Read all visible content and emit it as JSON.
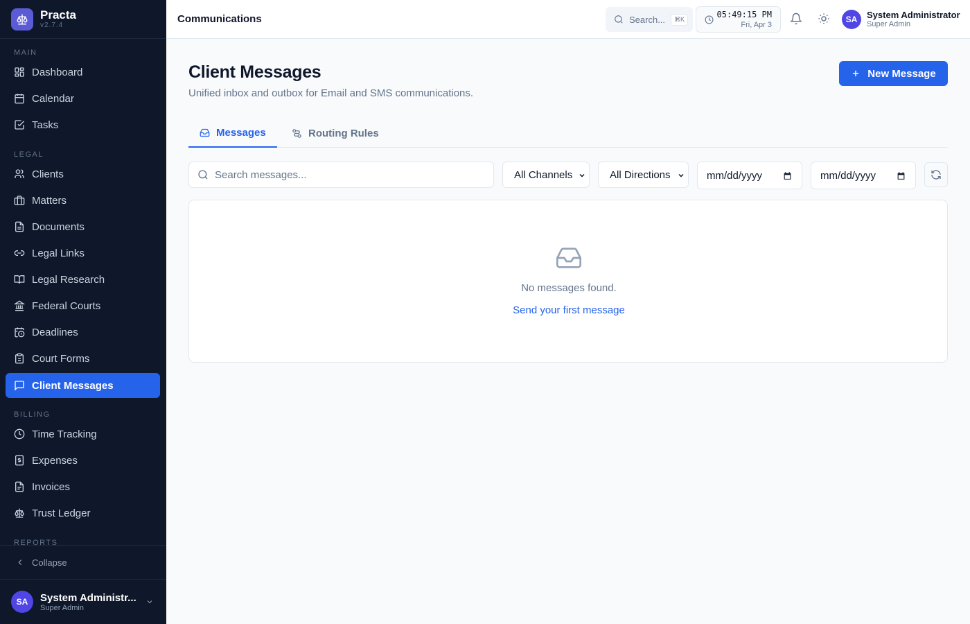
{
  "brand": {
    "name": "Practa",
    "version": "v2.7.4",
    "accent": "#5b5bd6"
  },
  "sidebar": {
    "sections": [
      "MAIN",
      "LEGAL",
      "BILLING",
      "REPORTS"
    ],
    "items": [
      {
        "label": "Dashboard",
        "icon": "dashboard-icon"
      },
      {
        "label": "Calendar",
        "icon": "calendar-icon"
      },
      {
        "label": "Tasks",
        "icon": "tasks-icon"
      },
      {
        "label": "Clients",
        "icon": "users-icon"
      },
      {
        "label": "Matters",
        "icon": "briefcase-icon"
      },
      {
        "label": "Documents",
        "icon": "document-icon"
      },
      {
        "label": "Legal Links",
        "icon": "link-icon"
      },
      {
        "label": "Legal Research",
        "icon": "book-icon"
      },
      {
        "label": "Federal Courts",
        "icon": "courthouse-icon"
      },
      {
        "label": "Deadlines",
        "icon": "calendar-clock-icon"
      },
      {
        "label": "Court Forms",
        "icon": "clipboard-icon"
      },
      {
        "label": "Client Messages",
        "icon": "message-icon",
        "active": true
      },
      {
        "label": "Time Tracking",
        "icon": "clock-icon"
      },
      {
        "label": "Expenses",
        "icon": "receipt-icon"
      },
      {
        "label": "Invoices",
        "icon": "invoice-icon"
      },
      {
        "label": "Trust Ledger",
        "icon": "scale-icon"
      }
    ],
    "collapse_label": "Collapse",
    "user": {
      "initials": "SA",
      "name": "System Administr...",
      "role": "Super Admin"
    }
  },
  "header": {
    "title": "Communications",
    "search_label": "Search...",
    "shortcut": "⌘K",
    "time": "05:49:15 PM",
    "date": "Fri, Apr 3",
    "user": {
      "initials": "SA",
      "name": "System Administrator",
      "role": "Super Admin"
    }
  },
  "main": {
    "title": "Client Messages",
    "subtitle": "Unified inbox and outbox for Email and SMS communications.",
    "new_button": "New Message",
    "tabs": [
      {
        "label": "Messages",
        "active": true
      },
      {
        "label": "Routing Rules",
        "active": false
      }
    ],
    "filters": {
      "search_placeholder": "Search messages...",
      "channel": "All Channels",
      "direction": "All Directions",
      "date_from": "mm/dd/yyyy",
      "date_to": "mm/dd/yyyy"
    },
    "empty": {
      "text": "No messages found.",
      "link": "Send your first message"
    }
  },
  "colors": {
    "primary": "#2563eb",
    "sidebar_bg": "#0f172a",
    "avatar": "#4f46e5"
  }
}
